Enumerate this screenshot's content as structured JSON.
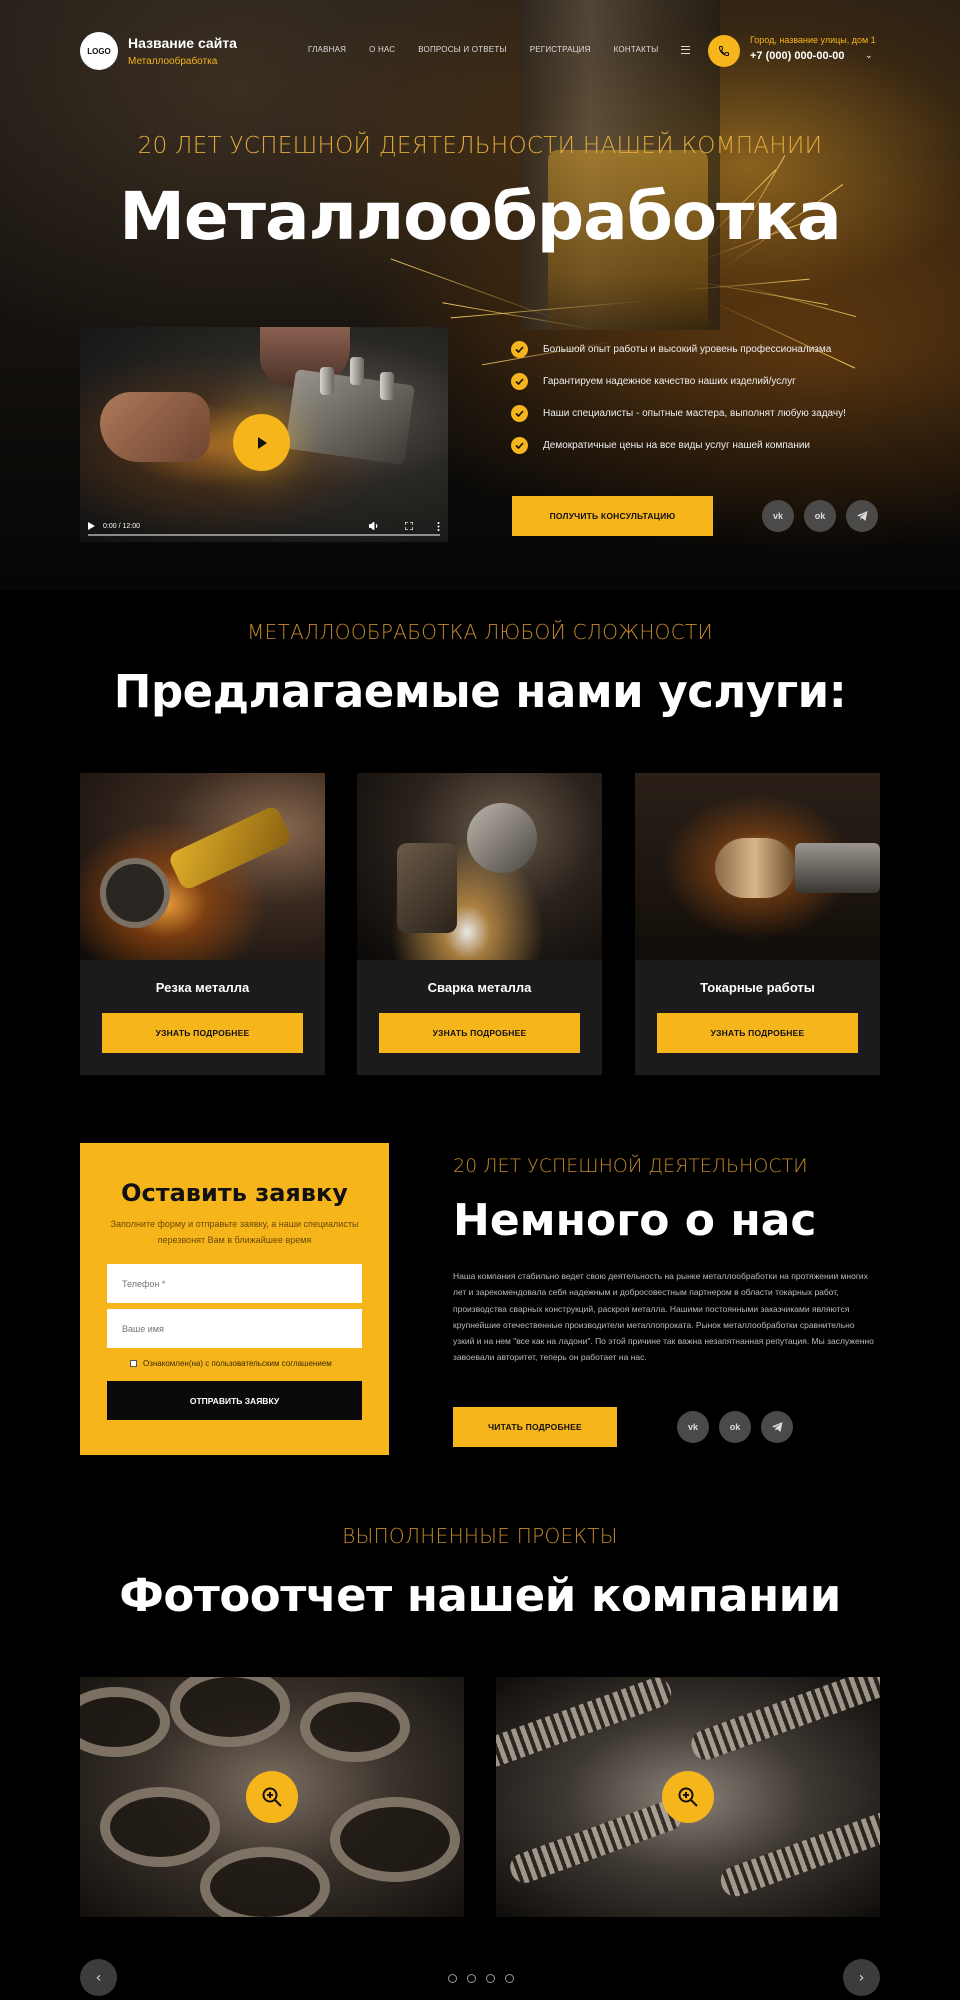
{
  "header": {
    "logo": "LOGO",
    "site_name": "Название сайта",
    "site_sub": "Металлообработка",
    "nav": [
      "Главная",
      "О нас",
      "Вопросы и ответы",
      "Регистрация",
      "Контакты"
    ],
    "address": "Город, название улицы, дом 1",
    "phone": "+7 (000) 000-00-00"
  },
  "hero": {
    "subtitle": "20 ЛЕТ УСПЕШНОЙ ДЕЯТЕЛЬНОСТИ НАШЕЙ КОМПАНИИ",
    "title": "Металлообработка",
    "video_time": "0:00 / 12:00",
    "benefits": [
      "Большой опыт работы и высокий уровень профессионализма",
      "Гарантируем надежное качество наших изделий/услуг",
      "Наши специалисты - опытные мастера, выполнят любую задачу!",
      "Демократичные цены на все виды услуг нашей компании"
    ],
    "cta": "Получить консультацию",
    "social": [
      "vk",
      "ok",
      "tg"
    ]
  },
  "services": {
    "subtitle": "МЕТАЛЛООБРАБОТКА ЛЮБОЙ СЛОЖНОСТИ",
    "title": "Предлагаемые нами услуги:",
    "items": [
      {
        "name": "Резка металла",
        "button": "Узнать подробнее"
      },
      {
        "name": "Сварка металла",
        "button": "Узнать подробнее"
      },
      {
        "name": "Токарные работы",
        "button": "Узнать подробнее"
      }
    ]
  },
  "form": {
    "title": "Оставить заявку",
    "description": "Заполните форму и отправьте заявку, а наши специалисты перезвонят Вам в ближайшее время",
    "phone_placeholder": "Телефон *",
    "name_placeholder": "Ваше имя",
    "consent": "Ознакомлен(на) с пользовательским соглашением",
    "submit": "Отправить заявку"
  },
  "about": {
    "subtitle": "20 ЛЕТ УСПЕШНОЙ ДЕЯТЕЛЬНОСТИ",
    "title": "Немного о нас",
    "text": "Наша компания стабильно ведет свою деятельность на рынке металлообработки на протяжении многих лет и зарекомендовала себя надежным и добросовестным партнером в области токарных работ, производства сварных конструкций, раскроя металла. Нашими постоянными заказчиками являются крупнейшие отечественные производители металлопроката. Рынок металлообработки сравнительно узкий и на нем \"все как на ладони\". По этой причине так важна незапятнанная репутация. Мы заслуженно завоевали авторитет, теперь он работает на нас.",
    "button": "Читать подробнее"
  },
  "projects": {
    "subtitle": "ВЫПОЛНЕННЫЕ ПРОЕКТЫ",
    "title": "Фотоотчет нашей компании",
    "prev": "‹",
    "next": "›",
    "dots_count": 4
  },
  "colors": {
    "accent": "#f7b51c",
    "background": "#000000",
    "card": "#1b1b1b",
    "subtitle": "#c48a2a"
  }
}
